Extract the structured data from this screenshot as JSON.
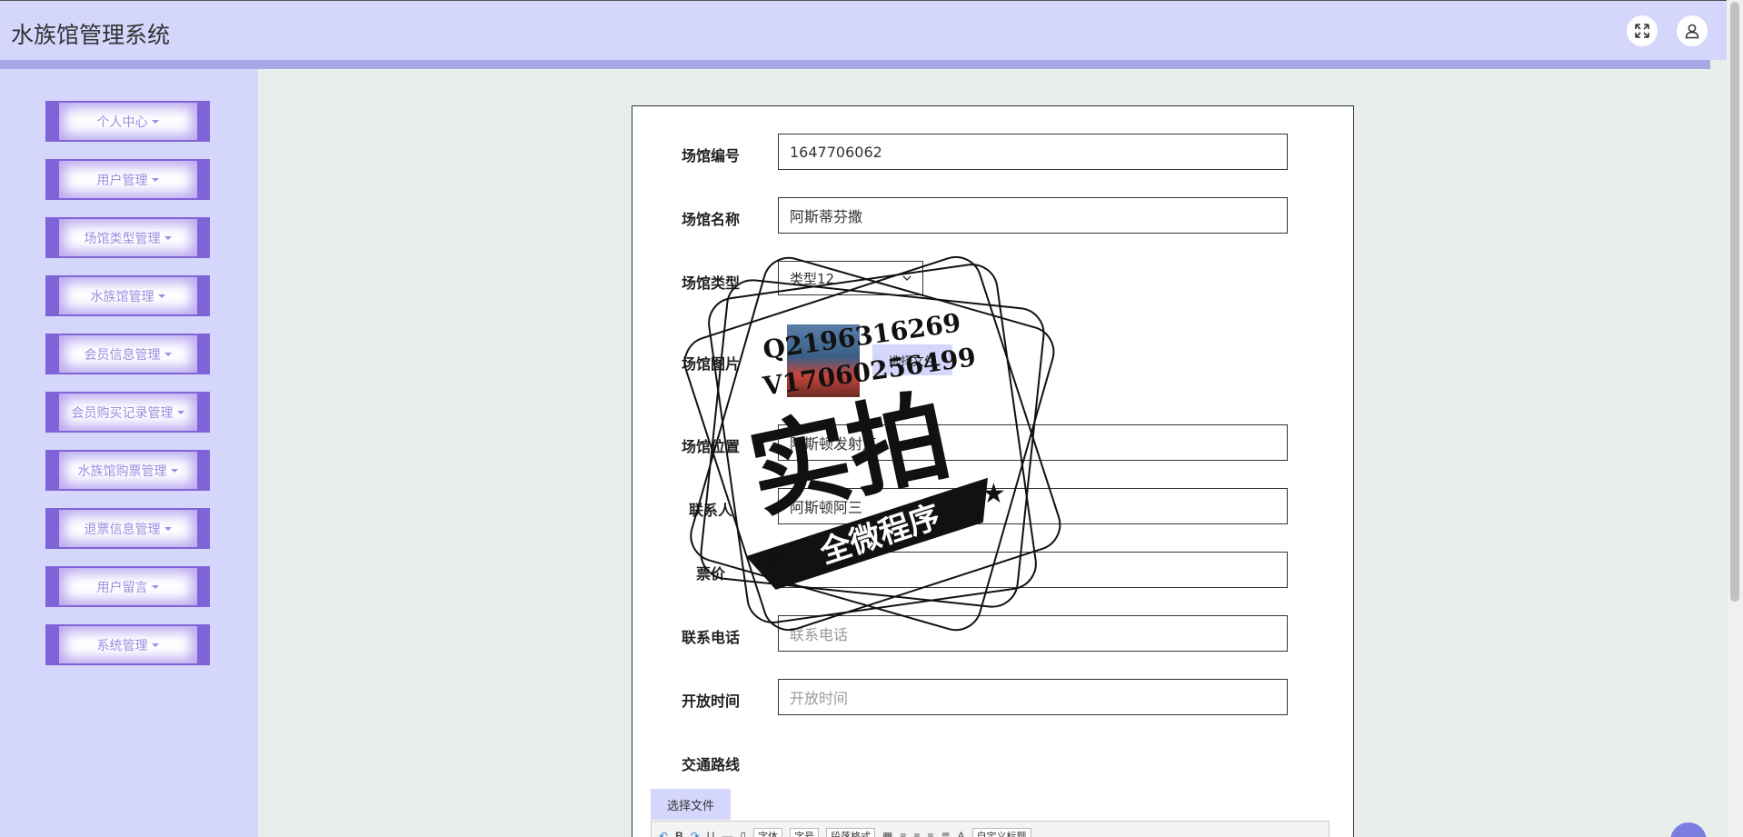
{
  "app": {
    "title": "水族馆管理系统"
  },
  "header": {
    "fullscreen_icon": "expand-icon",
    "user_icon": "user-icon"
  },
  "sidebar": {
    "items": [
      {
        "label": "个人中心"
      },
      {
        "label": "用户管理"
      },
      {
        "label": "场馆类型管理"
      },
      {
        "label": "水族馆管理"
      },
      {
        "label": "会员信息管理"
      },
      {
        "label": "会员购买记录管理"
      },
      {
        "label": "水族馆购票管理"
      },
      {
        "label": "退票信息管理"
      },
      {
        "label": "用户留言"
      },
      {
        "label": "系统管理"
      }
    ]
  },
  "form": {
    "venue_no": {
      "label": "场馆编号",
      "value": "1647706062"
    },
    "venue_name": {
      "label": "场馆名称",
      "value": "阿斯蒂芬撒"
    },
    "venue_type": {
      "label": "场馆类型",
      "value": "类型12"
    },
    "venue_image": {
      "label": "场馆图片",
      "button": "选择文件"
    },
    "venue_location": {
      "label": "场馆位置",
      "value": "阿斯顿发射点"
    },
    "contact": {
      "label": "联系人",
      "value": "阿斯顿阿三"
    },
    "ticket_price": {
      "label": "票价",
      "value": "11"
    },
    "phone": {
      "label": "联系电话",
      "placeholder": "联系电话"
    },
    "open_time": {
      "label": "开放时间",
      "placeholder": "开放时间"
    },
    "route": {
      "label": "交通路线",
      "button": "选择文件"
    }
  },
  "editor": {
    "font": "字体",
    "size": "字号",
    "paragraph": "段落格式",
    "custom_title": "自定义标题"
  },
  "watermark": {
    "line1": "Q2196316269",
    "line2": "V17060256499",
    "big": "实拍",
    "banner": "全微程序"
  }
}
